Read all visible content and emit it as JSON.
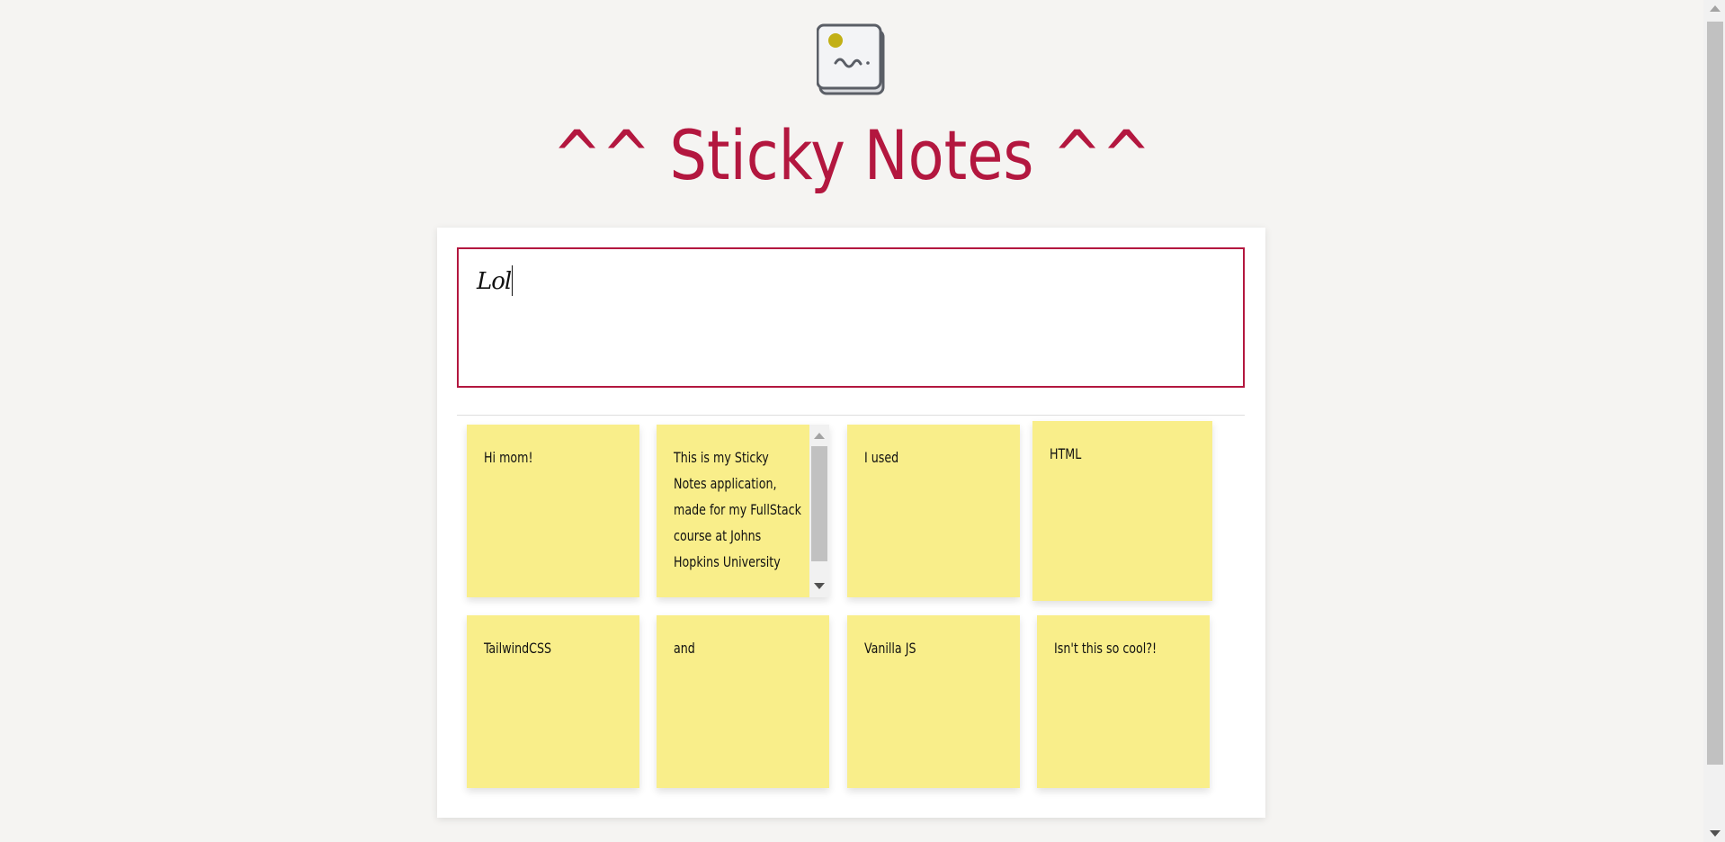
{
  "app": {
    "logo_icon": "sticky-note-icon",
    "title": "^^ Sticky Notes ^^",
    "accent_color": "#b3173f",
    "note_color": "#f9ee8a"
  },
  "editor": {
    "value": "Lol"
  },
  "notes": [
    {
      "text": "Hi mom!"
    },
    {
      "text": "This is my Sticky Notes application, made for my FullStack course at Johns Hopkins University"
    },
    {
      "text": "I used"
    },
    {
      "text": "HTML"
    },
    {
      "text": "TailwindCSS"
    },
    {
      "text": "and"
    },
    {
      "text": "Vanilla JS"
    },
    {
      "text": "Isn't this so cool?!"
    }
  ]
}
